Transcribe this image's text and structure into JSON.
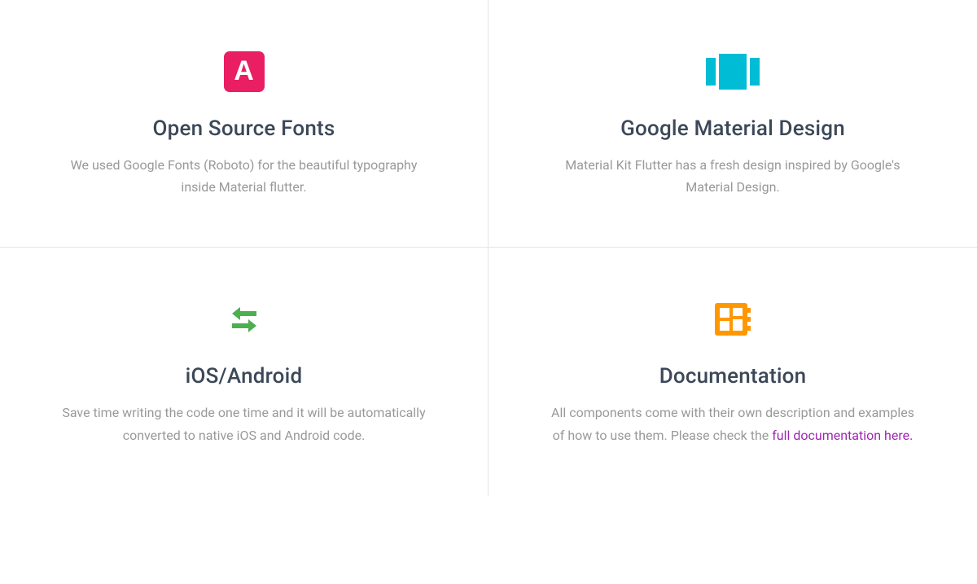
{
  "colors": {
    "pink": "#e91e63",
    "teal": "#00bcd4",
    "green": "#4caf50",
    "orange": "#ff9800",
    "link": "#9c27b0",
    "heading": "#3c4858",
    "body": "#999999"
  },
  "features": [
    {
      "icon": "fonts-icon",
      "icon_letter": "A",
      "title": "Open Source Fonts",
      "description": "We used Google Fonts (Roboto) for the beautiful typography inside Material flutter."
    },
    {
      "icon": "carousel-icon",
      "title": "Google Material Design",
      "description": "Material Kit Flutter has a fresh design inspired by Google's Material Design."
    },
    {
      "icon": "arrows-icon",
      "title": "iOS/Android",
      "description": "Save time writing the code one time and it will be automatically converted to native iOS and Android code."
    },
    {
      "icon": "board-icon",
      "title": "Documentation",
      "description_prefix": "All components come with their own description and examples of how to use them. Please check the ",
      "link_text": "full documentation here."
    }
  ]
}
